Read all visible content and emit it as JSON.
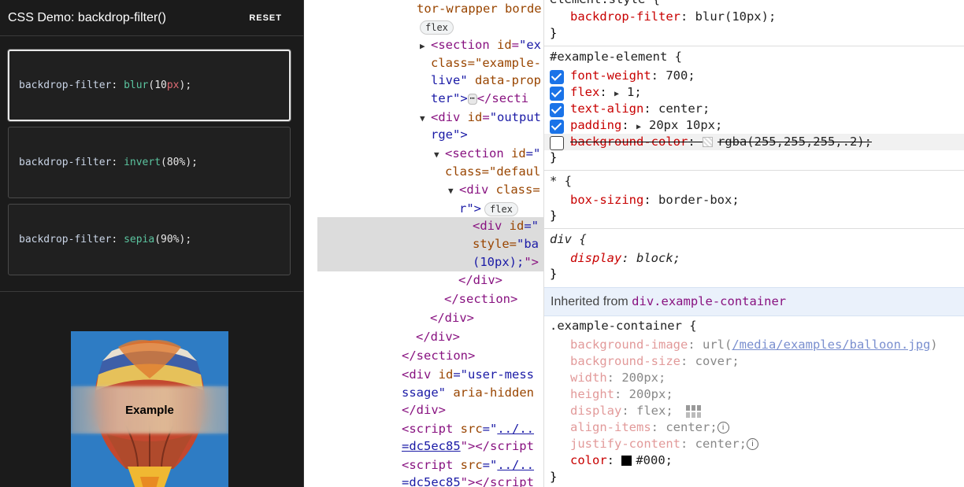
{
  "demo": {
    "title": "CSS Demo: backdrop-filter()",
    "reset_label": "RESET",
    "choices": [
      {
        "prop": "backdrop-filter",
        "fn": "blur",
        "num": "10",
        "unit": "px"
      },
      {
        "prop": "backdrop-filter",
        "fn": "invert",
        "num": "80",
        "unit": "%"
      },
      {
        "prop": "backdrop-filter",
        "fn": "sepia",
        "num": "90",
        "unit": "%"
      }
    ],
    "output_text": "Example",
    "colors": {
      "bg": "#1b1b1b",
      "accent_green": "#5bc49f"
    }
  },
  "elements": {
    "l1a": "tor-wrapper borde",
    "flex": "flex",
    "l3_tag": "<section",
    "l3_attr": "id",
    "l3_val": "\"ex",
    "l4": "class=\"example-",
    "l5a": "live\"",
    "l5b": "data-prop",
    "l6a": "ter\">",
    "l6b": "</secti",
    "l7_tag": "<div",
    "l7_attr": "id",
    "l7_val": "\"output",
    "l8": "rge\">",
    "l9_tag": "<section",
    "l9_attr": "id",
    "l9_val": "=\"",
    "l10": "class=\"defaul",
    "l11_tag": "<div",
    "l11_attr": "class=",
    "l12": "r\">",
    "l13_tag": "<div",
    "l13_attr": "id",
    "l13_val": "=\"",
    "l14a": "style=",
    "l14b": "\"ba",
    "l15a": "(10px);",
    "l15b": "\">",
    "l16": "</div>",
    "l17": "</section>",
    "l18": "</div>",
    "l19": "</div>",
    "l20": "</section>",
    "l21_tag": "<div",
    "l21_attr": "id",
    "l21_val": "=\"user-mess",
    "l22a": "ssage\"",
    "l22b": "aria-hidden",
    "l23": "</div>",
    "l24_tag": "<script",
    "l24_attr": "src",
    "l24_val": "=\"",
    "l24_link": "../..",
    "l25_val": "=dc5ec85",
    "l25_rest": "\"></script",
    "l26_tag": "<script",
    "l26_attr": "src",
    "l26_val": "=\"",
    "l26_link": "../..",
    "l27_val": "=dc5ec85",
    "l27_rest": "\"></script"
  },
  "styles": {
    "element_style_partial": "element.style {",
    "r0": {
      "prop": "backdrop-filter",
      "value": "blur(10px);"
    },
    "example_selector": "#example-element {",
    "rules": [
      {
        "prop": "font-weight",
        "value": "700;"
      },
      {
        "prop": "flex",
        "value": "1;"
      },
      {
        "prop": "text-align",
        "value": "center;"
      },
      {
        "prop": "padding",
        "value": "20px 10px;"
      },
      {
        "prop": "background-color",
        "value": "rgba(255,255,255,.2);"
      }
    ],
    "universal_selector": "* {",
    "universal_rule": {
      "prop": "box-sizing",
      "value": "border-box;"
    },
    "div_selector": "div {",
    "div_rule": {
      "prop": "display",
      "value": "block;"
    },
    "close": "}",
    "inherited_label": "Inherited from",
    "inherited_from": "div.example-container",
    "container_selector": ".example-container {",
    "container_rules": {
      "bgimage_prop": "background-image",
      "bgimage_pre": "url(",
      "bgimage_link": "/media/examples/balloon.jpg",
      "bgimage_post": ")",
      "bgsize_prop": "background-size",
      "bgsize_val": "cover;",
      "width_prop": "width",
      "width_val": "200px;",
      "height_prop": "height",
      "height_val": "200px;",
      "display_prop": "display",
      "display_val": "flex;",
      "align_prop": "align-items",
      "align_val": "center;",
      "justify_prop": "justify-content",
      "justify_val": "center;",
      "color_prop": "color",
      "color_val": "#000;"
    }
  }
}
